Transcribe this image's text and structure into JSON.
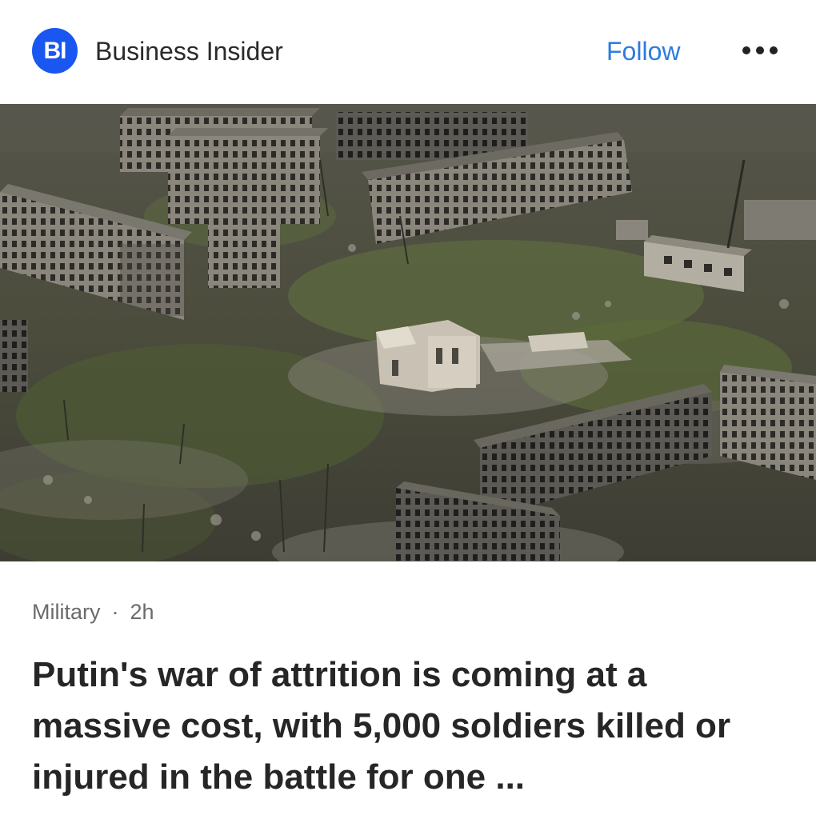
{
  "publisher": {
    "logo_text": "BI",
    "name": "Business Insider",
    "brand_color": "#1a56f0"
  },
  "header": {
    "follow_label": "Follow",
    "more_icon": "more-horizontal-icon",
    "follow_color": "#2d7be0"
  },
  "article": {
    "category": "Military",
    "separator": "·",
    "time_ago": "2h",
    "headline": "Putin's war of attrition is coming at a massive cost, with 5,000 soldiers killed or injured in the battle for one ...",
    "image_alt": "Aerial view of destroyed apartment blocks and ruins in a war-damaged city"
  }
}
